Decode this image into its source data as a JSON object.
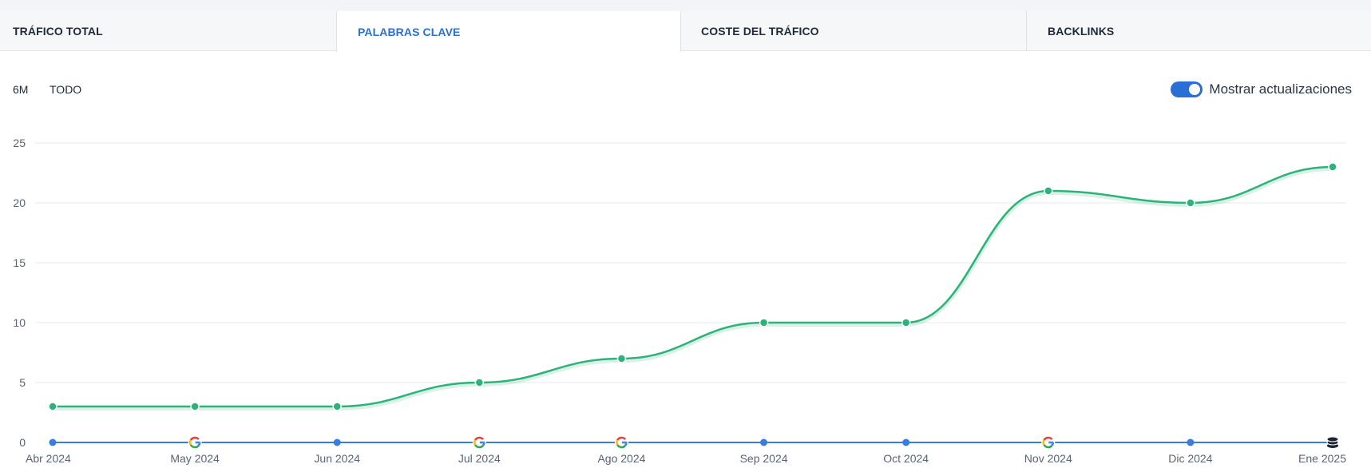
{
  "tabs": [
    {
      "label": "TRÁFICO TOTAL",
      "active": false
    },
    {
      "label": "PALABRAS CLAVE",
      "active": true
    },
    {
      "label": "COSTE DEL TRÁFICO",
      "active": false
    },
    {
      "label": "BACKLINKS",
      "active": false
    }
  ],
  "ranges": {
    "six_months": "6M",
    "all": "TODO"
  },
  "updates_toggle": {
    "label": "Mostrar actualizaciones",
    "on": true
  },
  "colors": {
    "series": "#2db37a",
    "baseline": "#3b7ddd",
    "grid": "#e6e9ee",
    "accent": "#2a6fd6"
  },
  "chart_data": {
    "type": "line",
    "categories": [
      "Abr 2024",
      "May 2024",
      "Jun 2024",
      "Jul 2024",
      "Ago 2024",
      "Sep 2024",
      "Oct 2024",
      "Nov 2024",
      "Dic 2024",
      "Ene 2025"
    ],
    "series": [
      {
        "values": [
          3,
          3,
          3,
          5,
          7,
          10,
          10,
          21,
          20,
          23
        ]
      }
    ],
    "yticks": [
      0,
      5,
      10,
      15,
      20,
      25
    ],
    "ylim": [
      0,
      25
    ],
    "grid": true,
    "update_markers": [
      "dot",
      "google-icon",
      "dot",
      "google-icon",
      "google-icon",
      "dot",
      "dot",
      "google-icon",
      "dot",
      "database-icon"
    ]
  }
}
